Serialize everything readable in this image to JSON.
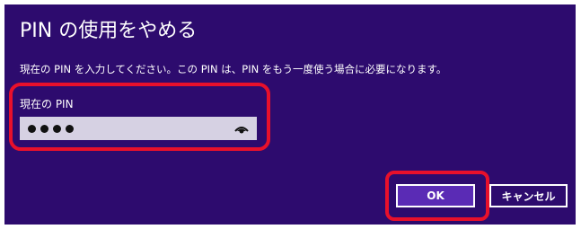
{
  "dialog": {
    "title": "PIN の使用をやめる",
    "description": "現在の PIN を入力してください。この PIN は、PIN をもう一度使う場合に必要になります。",
    "field_label": "現在の PIN",
    "pin_masked_length": 4,
    "ok_label": "OK",
    "cancel_label": "キャンセル"
  },
  "colors": {
    "background": "#2d0b6e",
    "accent_button": "#5a2bb5",
    "highlight": "#e8102b",
    "input_background": "#d6d1e3"
  },
  "icons": {
    "reveal": "eye-reveal-icon"
  }
}
